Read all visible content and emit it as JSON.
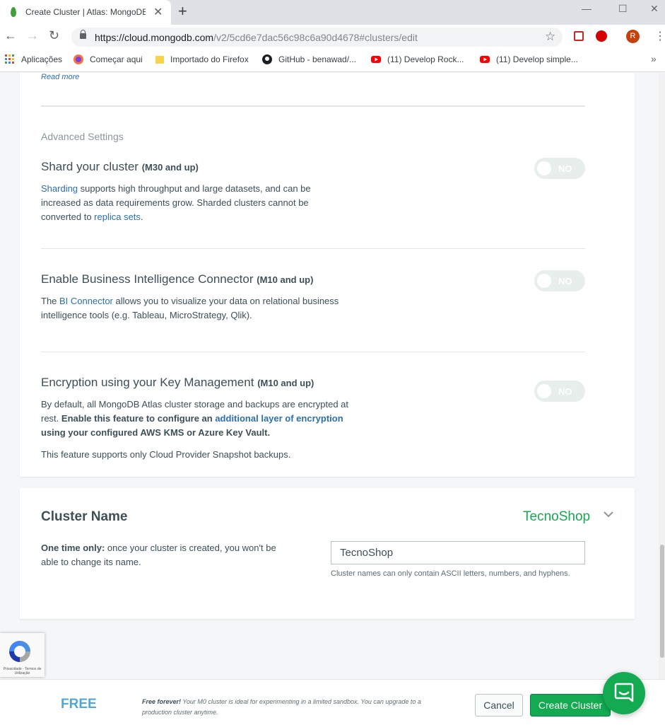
{
  "browser": {
    "tab_title": "Create Cluster | Atlas: MongoDB",
    "url_host": "https://cloud.mongodb.com",
    "url_path": "/v2/5cd6e7dac56c98c6a90d4678#clusters/edit",
    "profile_initial": "R",
    "bookmarks": [
      {
        "label": "Aplicações",
        "icon": "apps-grid-icon"
      },
      {
        "label": "Começar aqui",
        "icon": "firefox-icon"
      },
      {
        "label": "Importado do Firefox",
        "icon": "folder-icon"
      },
      {
        "label": "GitHub - benawad/...",
        "icon": "github-icon"
      },
      {
        "label": "(11) Develop Rock...",
        "icon": "youtube-icon"
      },
      {
        "label": "(11) Develop simple...",
        "icon": "youtube-icon"
      }
    ]
  },
  "advanced": {
    "read_more": "Read more",
    "section_label": "Advanced Settings",
    "shard": {
      "title": "Shard your cluster",
      "req": "(M30 and up)",
      "link1": "Sharding",
      "text1": " supports high throughput and large datasets, and can be increased as data requirements grow. Sharded clusters cannot be converted to ",
      "link2": "replica sets",
      "text2": ".",
      "toggle": "NO"
    },
    "bi": {
      "title": "Enable Business Intelligence Connector",
      "req": "(M10 and up)",
      "text0": "The ",
      "link1": "BI Connector",
      "text1": " allows you to visualize your data on relational business intelligence tools (e.g. Tableau, MicroStrategy, Qlik).",
      "toggle": "NO"
    },
    "encryption": {
      "title": "Encryption using your Key Management",
      "req": "(M10 and up)",
      "text1": "By default, all MongoDB Atlas cluster storage and backups are encrypted at rest. ",
      "bold1": "Enable this feature to configure an ",
      "link1": "additional layer of encryption",
      "bold2": " using your configured AWS KMS or Azure Key Vault.",
      "note": "This feature supports only Cloud Provider Snapshot backups.",
      "toggle": "NO"
    }
  },
  "cluster_name": {
    "title": "Cluster Name",
    "value": "TecnoShop",
    "note_bold": "One time only:",
    "note_text": " once your cluster is created, you won't be able to change its name.",
    "input_value": "TecnoShop",
    "hint": "Cluster names can only contain ASCII letters, numbers, and hyphens."
  },
  "recaptcha": {
    "text": "Privacidade - Termos de Utilização"
  },
  "footer": {
    "tier": "FREE",
    "desc_bold": "Free forever!",
    "desc_text": " Your M0 cluster is ideal for experimenting in a limited sandbox. You can upgrade to a production cluster anytime.",
    "cancel": "Cancel",
    "create": "Create Cluster"
  },
  "colors": {
    "accent_green": "#13aa52",
    "link_blue": "#2b6fb0",
    "free_blue": "#4fa8d8"
  }
}
